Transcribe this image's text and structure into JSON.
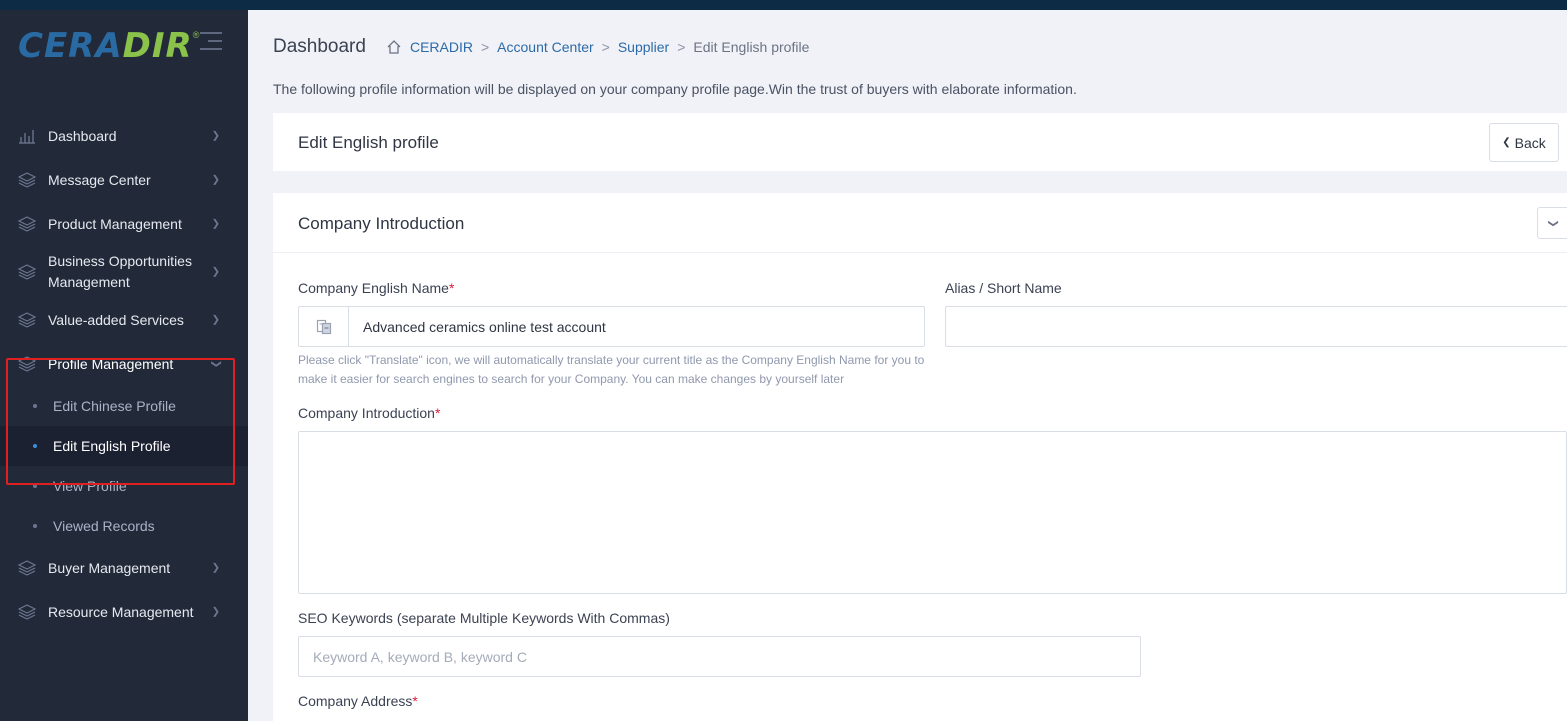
{
  "brand": {
    "logo_main": "CERA",
    "logo_accent": "DIR",
    "logo_mark": "®"
  },
  "sidebar": {
    "items": [
      {
        "label": "Dashboard",
        "icon": "dashboard-chart-icon"
      },
      {
        "label": "Message Center",
        "icon": "layers-icon"
      },
      {
        "label": "Product Management",
        "icon": "layers-icon"
      },
      {
        "label": "Business Opportunities Management",
        "icon": "layers-icon"
      },
      {
        "label": "Value-added Services",
        "icon": "layers-icon"
      },
      {
        "label": "Profile Management",
        "icon": "layers-icon",
        "expanded": true
      },
      {
        "label": "Buyer Management",
        "icon": "layers-icon"
      },
      {
        "label": "Resource Management",
        "icon": "layers-icon"
      }
    ],
    "profile_subitems": [
      {
        "label": "Edit Chinese Profile"
      },
      {
        "label": "Edit English Profile",
        "current": true
      },
      {
        "label": "View Profile"
      },
      {
        "label": "Viewed Records"
      }
    ]
  },
  "header": {
    "page_title": "Dashboard",
    "breadcrumb": [
      "CERADIR",
      "Account Center",
      "Supplier",
      "Edit English profile"
    ],
    "breadcrumb_sep": ">",
    "note": "The following profile information will be displayed on your company profile page.Win the trust of buyers with elaborate information."
  },
  "edit_card": {
    "title": "Edit English profile",
    "back_label": "Back"
  },
  "company_intro": {
    "title": "Company Introduction",
    "english_name_label": "Company English Name",
    "english_name_value": "Advanced ceramics online test account",
    "alias_label": "Alias / Short Name",
    "alias_value": "",
    "help_text": "Please click \"Translate\" icon, we will automatically translate your current title as the Company English Name for you to make it easier for search engines to search for your Company. You can make changes by yourself later",
    "intro_label": "Company Introduction",
    "intro_value": "",
    "seo_label": "SEO Keywords (separate Multiple Keywords With Commas)",
    "seo_placeholder": "Keyword A, keyword B, keyword C",
    "address_label": "Company Address",
    "required_mark": "*"
  },
  "colors": {
    "sidebar_bg": "#222a3a",
    "topbar": "#0d2b45",
    "link": "#2c6aa8",
    "required": "#e0193a",
    "highlight": "#e02020"
  }
}
